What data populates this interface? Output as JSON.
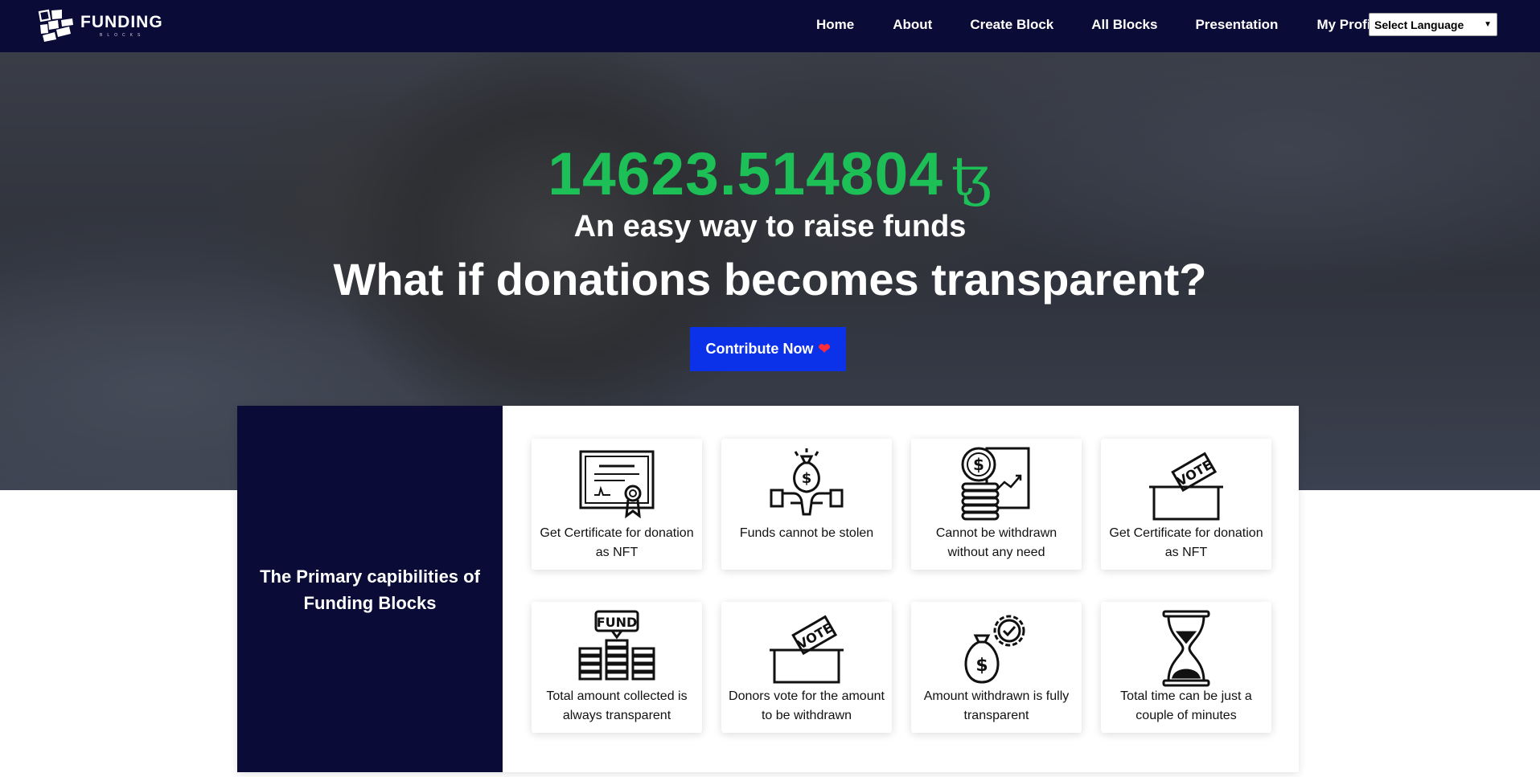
{
  "brand": {
    "name": "FUNDING",
    "sub": "BLOCKS"
  },
  "nav": {
    "links": [
      "Home",
      "About",
      "Create Block",
      "All Blocks",
      "Presentation",
      "My Profile"
    ],
    "language_label": "Select Language"
  },
  "hero": {
    "amount": "14623.514804",
    "currency_symbol": "ꜩ",
    "subtitle": "An easy way to raise funds",
    "question": "What if donations becomes transparent?",
    "cta_label": "Contribute Now",
    "cta_icon": "heart-icon"
  },
  "capabilities": {
    "title": "The Primary capibilities of Funding Blocks",
    "cards": [
      {
        "icon": "certificate-icon",
        "label": "Get Certificate for donation as NFT"
      },
      {
        "icon": "money-bag-hands-icon",
        "label": "Funds cannot be stolen"
      },
      {
        "icon": "coins-chart-icon",
        "label": "Cannot be withdrawn without any need"
      },
      {
        "icon": "vote-box-icon",
        "label": "Get Certificate for donation as NFT"
      },
      {
        "icon": "fund-coins-icon",
        "label": "Total amount collected is always transparent"
      },
      {
        "icon": "vote-box-icon",
        "label": "Donors vote for the amount to be withdrawn"
      },
      {
        "icon": "money-bag-gear-icon",
        "label": "Amount withdrawn is fully transparent"
      },
      {
        "icon": "hourglass-icon",
        "label": "Total time can be just a couple of minutes"
      }
    ]
  },
  "colors": {
    "navy": "#0a0b36",
    "green": "#1dbf57",
    "blue": "#0b32e8",
    "heart": "#ff2a3a"
  }
}
